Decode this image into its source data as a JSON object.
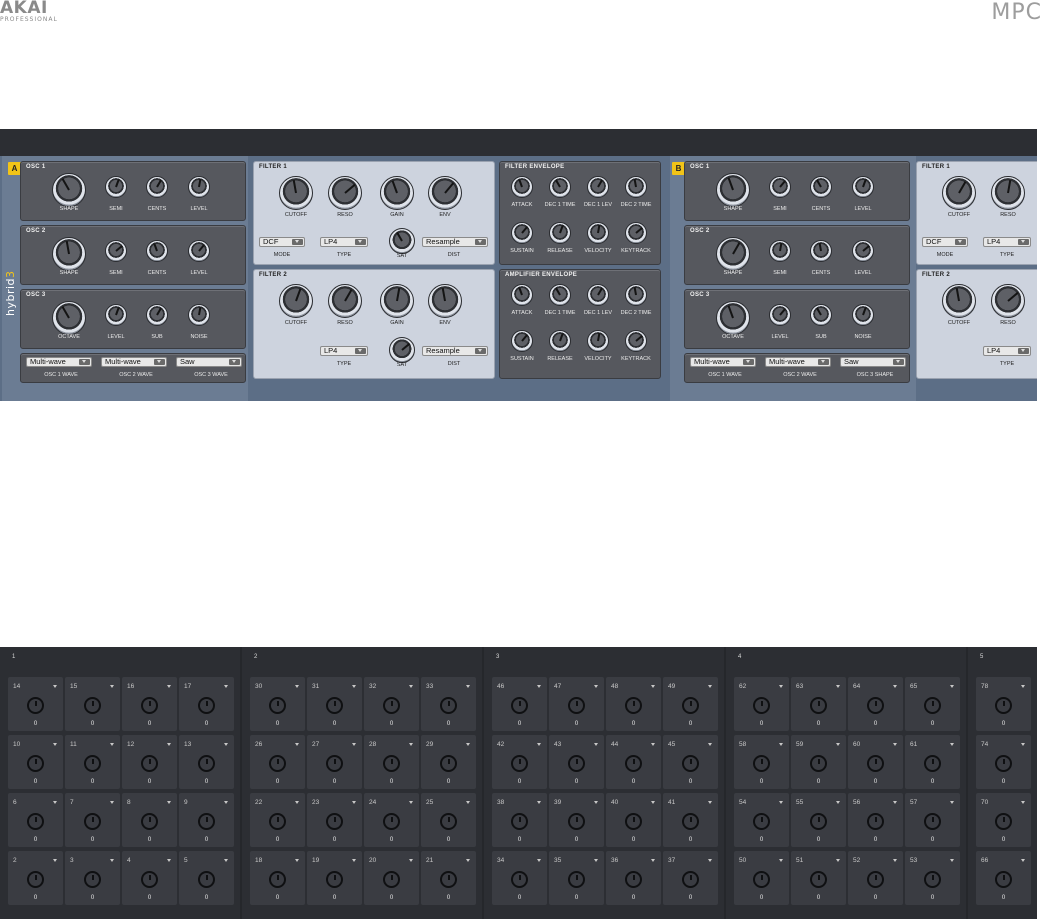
{
  "header": {
    "brand": "AKAI",
    "brand_sub": "PROFESSIONAL",
    "product": "MPC"
  },
  "colors": {
    "badge": "#f2c418",
    "synth_body": "#5c6e86",
    "panel_dark": "#56585e",
    "panel_light": "#cdd3de",
    "mixer_bg": "#25272b"
  },
  "synth": {
    "brand_prefix": "hybrid",
    "brand_number": "3",
    "pages": [
      {
        "badge": "A",
        "osc1": {
          "title": "OSC 1",
          "knobs": [
            "SHAPE",
            "SEMI",
            "CENTS",
            "LEVEL"
          ]
        },
        "osc2": {
          "title": "OSC 2",
          "knobs": [
            "SHAPE",
            "SEMI",
            "CENTS",
            "LEVEL"
          ]
        },
        "osc3": {
          "title": "OSC 3",
          "knobs": [
            "OCTAVE",
            "LEVEL",
            "SUB",
            "NOISE"
          ]
        },
        "waves": [
          {
            "value": "Multi-wave",
            "label": "OSC 1 WAVE"
          },
          {
            "value": "Multi-wave",
            "label": "OSC 2 WAVE"
          },
          {
            "value": "Saw",
            "label": "OSC 3 WAVE"
          }
        ],
        "filter1": {
          "title": "FILTER 1",
          "knobs": [
            "CUTOFF",
            "RESO",
            "GAIN",
            "ENV"
          ],
          "mode": {
            "value": "DCF",
            "label": "MODE"
          },
          "type": {
            "value": "LP4",
            "label": "TYPE"
          },
          "sat": "SAT",
          "dist": {
            "value": "Resample",
            "label": "DIST"
          }
        },
        "filter2": {
          "title": "FILTER 2",
          "knobs": [
            "CUTOFF",
            "RESO",
            "GAIN",
            "ENV"
          ],
          "type": {
            "value": "LP4",
            "label": "TYPE"
          },
          "sat": "SAT",
          "dist": {
            "value": "Resample",
            "label": "DIST"
          }
        },
        "filter_env": {
          "title": "FILTER ENVELOPE",
          "row1": [
            "ATTACK",
            "DEC 1 TIME",
            "DEC 1 LEV",
            "DEC 2 TIME"
          ],
          "row2": [
            "SUSTAIN",
            "RELEASE",
            "VELOCITY",
            "KEYTRACK"
          ]
        },
        "amp_env": {
          "title": "AMPLIFIER ENVELOPE",
          "row1": [
            "ATTACK",
            "DEC 1 TIME",
            "DEC 1 LEV",
            "DEC 2 TIME"
          ],
          "row2": [
            "SUSTAIN",
            "RELEASE",
            "VELOCITY",
            "KEYTRACK"
          ]
        }
      },
      {
        "badge": "B",
        "osc1": {
          "title": "OSC 1",
          "knobs": [
            "SHAPE",
            "SEMI",
            "CENTS",
            "LEVEL"
          ]
        },
        "osc2": {
          "title": "OSC 2",
          "knobs": [
            "SHAPE",
            "SEMI",
            "CENTS",
            "LEVEL"
          ]
        },
        "osc3": {
          "title": "OSC 3",
          "knobs": [
            "OCTAVE",
            "LEVEL",
            "SUB",
            "NOISE"
          ]
        },
        "waves": [
          {
            "value": "Multi-wave",
            "label": "OSC 1 WAVE"
          },
          {
            "value": "Multi-wave",
            "label": "OSC 2 WAVE"
          },
          {
            "value": "Saw",
            "label": "OSC 3 SHAPE"
          }
        ],
        "filter1": {
          "title": "FILTER 1",
          "knobs": [
            "CUTOFF",
            "RESO"
          ],
          "mode": {
            "value": "DCF",
            "label": "MODE"
          },
          "type": {
            "value": "LP4",
            "label": "TYPE"
          }
        },
        "filter2": {
          "title": "FILTER 2",
          "knobs": [
            "CUTOFF",
            "RESO"
          ],
          "type": {
            "value": "LP4",
            "label": "TYPE"
          }
        }
      }
    ]
  },
  "mixer": {
    "sections": [
      {
        "label": "1",
        "rows": [
          [
            "14",
            "15",
            "16",
            "17"
          ],
          [
            "10",
            "11",
            "12",
            "13"
          ],
          [
            "6",
            "7",
            "8",
            "9"
          ],
          [
            "2",
            "3",
            "4",
            "5"
          ]
        ]
      },
      {
        "label": "2",
        "rows": [
          [
            "30",
            "31",
            "32",
            "33"
          ],
          [
            "26",
            "27",
            "28",
            "29"
          ],
          [
            "22",
            "23",
            "24",
            "25"
          ],
          [
            "18",
            "19",
            "20",
            "21"
          ]
        ]
      },
      {
        "label": "3",
        "rows": [
          [
            "46",
            "47",
            "48",
            "49"
          ],
          [
            "42",
            "43",
            "44",
            "45"
          ],
          [
            "38",
            "39",
            "40",
            "41"
          ],
          [
            "34",
            "35",
            "36",
            "37"
          ]
        ]
      },
      {
        "label": "4",
        "rows": [
          [
            "62",
            "63",
            "64",
            "65"
          ],
          [
            "58",
            "59",
            "60",
            "61"
          ],
          [
            "54",
            "55",
            "56",
            "57"
          ],
          [
            "50",
            "51",
            "52",
            "53"
          ]
        ]
      },
      {
        "label": "5",
        "rows": [
          [
            "78"
          ],
          [
            "74"
          ],
          [
            "70"
          ],
          [
            "66"
          ]
        ]
      }
    ],
    "cell_value": "0"
  }
}
